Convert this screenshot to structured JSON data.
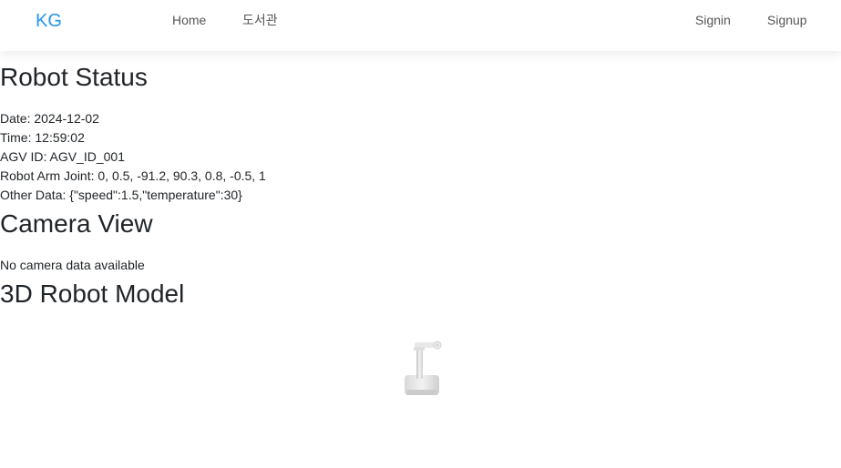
{
  "navbar": {
    "brand": "KG",
    "links": [
      "Home",
      "도서관"
    ],
    "auth": [
      "Signin",
      "Signup"
    ]
  },
  "status": {
    "title": "Robot Status",
    "date_label": "Date:",
    "date": "2024-12-02",
    "time_label": "Time:",
    "time": "12:59:02",
    "agv_label": "AGV ID:",
    "agv_id": "AGV_ID_001",
    "joint_label": "Robot Arm Joint:",
    "joints": "0, 0.5, -91.2, 90.3, 0.8, -0.5, 1",
    "other_label": "Other Data:",
    "other": "{\"speed\":1.5,\"temperature\":30}"
  },
  "camera": {
    "title": "Camera View",
    "message": "No camera data available"
  },
  "model": {
    "title": "3D Robot Model"
  },
  "colors": {
    "brand": "#2196f3",
    "nav_text": "#555555",
    "text": "#212529",
    "robot": "#e6e6e6"
  },
  "icons": [
    "robot-arm-model"
  ]
}
